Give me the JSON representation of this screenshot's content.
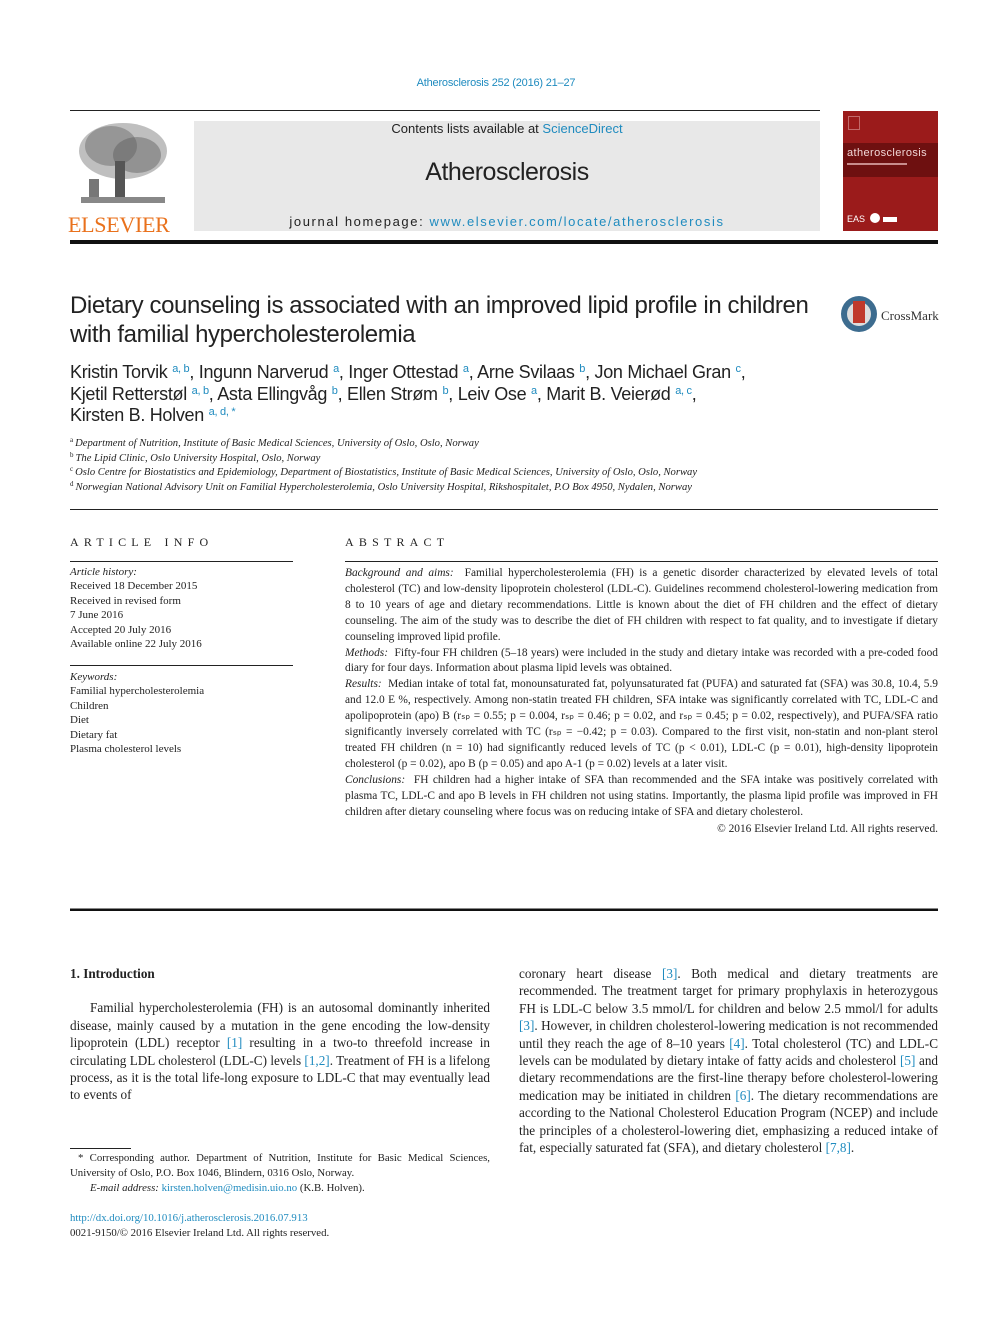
{
  "header": {
    "journal_ref": "Atherosclerosis 252 (2016) 21–27",
    "publisher_wordmark": "ELSEVIER",
    "contents_prefix": "Contents lists available at ",
    "contents_link": "ScienceDirect",
    "journal_name": "Atherosclerosis",
    "homepage_prefix": "journal homepage: ",
    "homepage_link": "www.elsevier.com/locate/atherosclerosis",
    "cover_title": "atherosclerosis",
    "cover_society": "EAS"
  },
  "article": {
    "title": "Dietary counseling is associated with an improved lipid profile in children with familial hypercholesterolemia",
    "crossmark_label": "CrossMark",
    "authors": [
      {
        "name": "Kristin Torvik",
        "sup": "a, b",
        "sep": ", "
      },
      {
        "name": "Ingunn Narverud",
        "sup": "a",
        "sep": ", "
      },
      {
        "name": "Inger Ottestad",
        "sup": "a",
        "sep": ", "
      },
      {
        "name": "Arne Svilaas",
        "sup": "b",
        "sep": ", "
      },
      {
        "name": "Jon Michael Gran",
        "sup": "c",
        "sep": ","
      },
      {
        "name": "Kjetil Retterstøl",
        "sup": "a, b",
        "sep": ", "
      },
      {
        "name": "Asta Ellingvåg",
        "sup": "b",
        "sep": ", "
      },
      {
        "name": "Ellen Strøm",
        "sup": "b",
        "sep": ", "
      },
      {
        "name": "Leiv Ose",
        "sup": "a",
        "sep": ", "
      },
      {
        "name": "Marit B. Veierød",
        "sup": "a, c",
        "sep": ","
      },
      {
        "name": "Kirsten B. Holven",
        "sup": "a, d, *",
        "sep": ""
      }
    ],
    "affiliations": [
      {
        "key": "a",
        "text": "Department of Nutrition, Institute of Basic Medical Sciences, University of Oslo, Oslo, Norway"
      },
      {
        "key": "b",
        "text": "The Lipid Clinic, Oslo University Hospital, Oslo, Norway"
      },
      {
        "key": "c",
        "text": "Oslo Centre for Biostatistics and Epidemiology, Department of Biostatistics, Institute of Basic Medical Sciences, University of Oslo, Oslo, Norway"
      },
      {
        "key": "d",
        "text": "Norwegian National Advisory Unit on Familial Hypercholesterolemia, Oslo University Hospital, Rikshospitalet, P.O Box 4950, Nydalen, Norway"
      }
    ]
  },
  "article_info": {
    "heading": "ARTICLE INFO",
    "history_label": "Article history:",
    "history": [
      "Received 18 December 2015",
      "Received in revised form",
      "7 June 2016",
      "Accepted 20 July 2016",
      "Available online 22 July 2016"
    ],
    "keywords_label": "Keywords:",
    "keywords": [
      "Familial hypercholesterolemia",
      "Children",
      "Diet",
      "Dietary fat",
      "Plasma cholesterol levels"
    ]
  },
  "abstract": {
    "heading": "ABSTRACT",
    "sections": [
      {
        "label": "Background and aims:",
        "text": "Familial hypercholesterolemia (FH) is a genetic disorder characterized by elevated levels of total cholesterol (TC) and low-density lipoprotein cholesterol (LDL-C). Guidelines recommend cholesterol-lowering medication from 8 to 10 years of age and dietary recommendations. Little is known about the diet of FH children and the effect of dietary counseling. The aim of the study was to describe the diet of FH children with respect to fat quality, and to investigate if dietary counseling improved lipid profile."
      },
      {
        "label": "Methods:",
        "text": "Fifty-four FH children (5–18 years) were included in the study and dietary intake was recorded with a pre-coded food diary for four days. Information about plasma lipid levels was obtained."
      },
      {
        "label": "Results:",
        "text": "Median intake of total fat, monounsaturated fat, polyunsaturated fat (PUFA) and saturated fat (SFA) was 30.8, 10.4, 5.9 and 12.0 E %, respectively. Among non-statin treated FH children, SFA intake was significantly correlated with TC, LDL-C and apolipoprotein (apo) B (rₛₚ = 0.55; p = 0.004, rₛₚ = 0.46; p = 0.02, and rₛₚ = 0.45; p = 0.02, respectively), and PUFA/SFA ratio significantly inversely correlated with TC (rₛₚ = −0.42; p = 0.03). Compared to the first visit, non-statin and non-plant sterol treated FH children (n = 10) had significantly reduced levels of TC (p < 0.01), LDL-C (p = 0.01), high-density lipoprotein cholesterol (p = 0.02), apo B (p = 0.05) and apo A-1 (p = 0.02) levels at a later visit."
      },
      {
        "label": "Conclusions:",
        "text": "FH children had a higher intake of SFA than recommended and the SFA intake was positively correlated with plasma TC, LDL-C and apo B levels in FH children not using statins. Importantly, the plasma lipid profile was improved in FH children after dietary counseling where focus was on reducing intake of SFA and dietary cholesterol."
      }
    ],
    "copyright": "© 2016 Elsevier Ireland Ltd. All rights reserved."
  },
  "body": {
    "section_heading": "1.  Introduction",
    "left_paragraph": [
      {
        "t": "Familial hypercholesterolemia (FH) is an autosomal dominantly inherited disease, mainly caused by a mutation in the gene encoding the low-density lipoprotein (LDL) receptor "
      },
      {
        "ref": "[1]"
      },
      {
        "t": " resulting in a two-to threefold increase in circulating LDL cholesterol (LDL-C) levels "
      },
      {
        "ref": "[1,2]"
      },
      {
        "t": ". Treatment of FH is a lifelong process, as it is the total life-long exposure to LDL-C that may eventually lead to events of"
      }
    ],
    "right_paragraph": [
      {
        "t": "coronary heart disease "
      },
      {
        "ref": "[3]"
      },
      {
        "t": ". Both medical and dietary treatments are recommended. The treatment target for primary prophylaxis in heterozygous FH is LDL-C below 3.5 mmol/L for children and below 2.5 mmol/l for adults "
      },
      {
        "ref": "[3]"
      },
      {
        "t": ". However, in children cholesterol-lowering medication is not recommended until they reach the age of 8–10 years "
      },
      {
        "ref": "[4]"
      },
      {
        "t": ". Total cholesterol (TC) and LDL-C levels can be modulated by dietary intake of fatty acids and cholesterol "
      },
      {
        "ref": "[5]"
      },
      {
        "t": " and dietary recommendations are the first-line therapy before cholesterol-lowering medication may be initiated in children "
      },
      {
        "ref": "[6]"
      },
      {
        "t": ". The dietary recommendations are according to the National Cholesterol Education Program (NCEP) and include the principles of a cholesterol-lowering diet, emphasizing a reduced intake of fat, especially saturated fat (SFA), and dietary cholesterol "
      },
      {
        "ref": "[7,8]"
      },
      {
        "t": "."
      }
    ]
  },
  "footnote": {
    "corresponding": "* Corresponding author. Department of Nutrition, Institute for Basic Medical Sciences, University of Oslo, P.O. Box 1046, Blindern, 0316 Oslo, Norway.",
    "email_label": "E-mail address:",
    "email": "kirsten.holven@medisin.uio.no",
    "email_suffix": " (K.B. Holven).",
    "doi": "http://dx.doi.org/10.1016/j.atherosclerosis.2016.07.913",
    "issn_copyright": "0021-9150/© 2016 Elsevier Ireland Ltd. All rights reserved."
  },
  "colors": {
    "link": "#1f8bbf",
    "elsevier_orange": "#e9711c",
    "cover_red": "#9b1b1b",
    "masthead_gray": "#e8e8e8"
  }
}
